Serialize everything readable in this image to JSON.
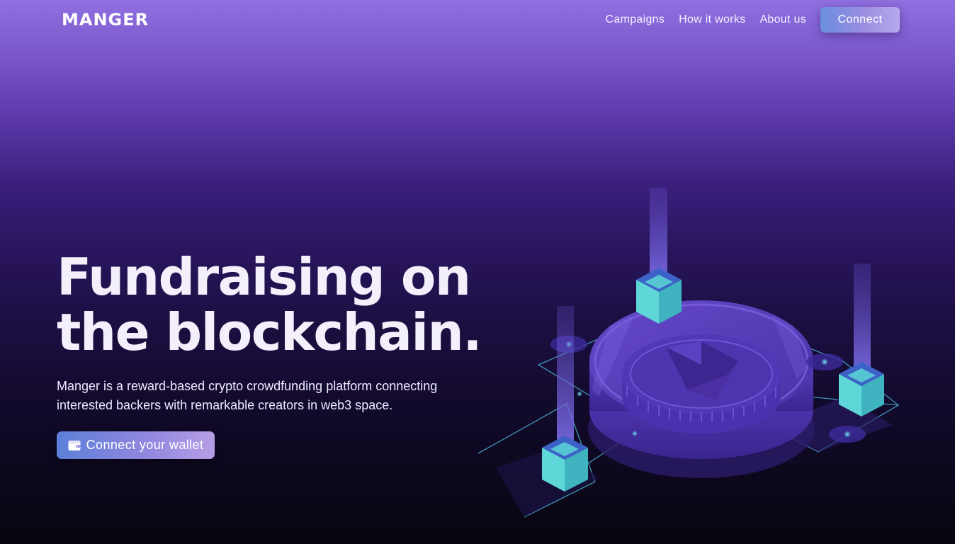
{
  "brand": {
    "logo_text": "MANGER"
  },
  "nav": {
    "links": [
      "Campaigns",
      "How it works",
      "About us"
    ],
    "connect_label": "Connect"
  },
  "hero": {
    "title_line1": "Fundraising on",
    "title_line2": "the blockchain.",
    "subtitle_line1": "Manger is a reward-based crypto crowdfunding platform connecting",
    "subtitle_line2": "interested backers with remarkable creators in web3 space.",
    "cta_label": "Connect your wallet",
    "cta_icon": "wallet-icon"
  },
  "illustration": {
    "name": "blockchain-coin-illustration",
    "coin_symbol": "ethereum-icon"
  },
  "colors": {
    "accent_start": "#5c80d8",
    "accent_end": "#b79ee6",
    "cube": "#4fc3c9",
    "coin": "#5a3fb8",
    "bg_top": "#9070e0",
    "bg_bottom": "#08050f"
  }
}
